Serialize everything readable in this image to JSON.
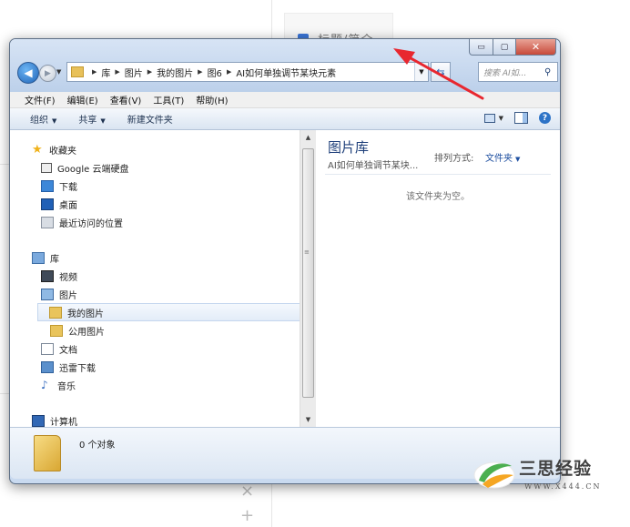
{
  "background": {
    "card_title": "标题/简介",
    "close_symbol": "×",
    "add_symbol": "+"
  },
  "caption_buttons": {
    "minimize": "▭",
    "maximize": "▢",
    "close": "✕"
  },
  "address_bar": {
    "segments": [
      "库",
      "图片",
      "我的图片",
      "图6",
      "AI如何单独调节某块元素"
    ],
    "search_placeholder": "搜索 AI如..."
  },
  "menu": [
    "文件(F)",
    "编辑(E)",
    "查看(V)",
    "工具(T)",
    "帮助(H)"
  ],
  "commands": {
    "organize": "组织",
    "share": "共享",
    "new_folder": "新建文件夹",
    "help": "?"
  },
  "nav_tree": {
    "favorites": {
      "label": "收藏夹",
      "items": [
        "Google 云端硬盘",
        "下载",
        "桌面",
        "最近访问的位置"
      ]
    },
    "libraries": {
      "label": "库",
      "items": [
        "视频",
        "图片",
        "我的图片",
        "公用图片",
        "文档",
        "迅雷下载",
        "音乐"
      ]
    },
    "computer": "计算机"
  },
  "content": {
    "library_title": "图片库",
    "library_subtitle": "AI如何单独调节某块...",
    "arrange_label": "排列方式:",
    "arrange_value": "文件夹",
    "empty_message": "该文件夹为空。"
  },
  "details": {
    "object_count": "0 个对象"
  },
  "watermark": {
    "text": "三思经验",
    "url": "WWW.X444.CN"
  },
  "colors": {
    "annotation_arrow": "#e8272f"
  }
}
